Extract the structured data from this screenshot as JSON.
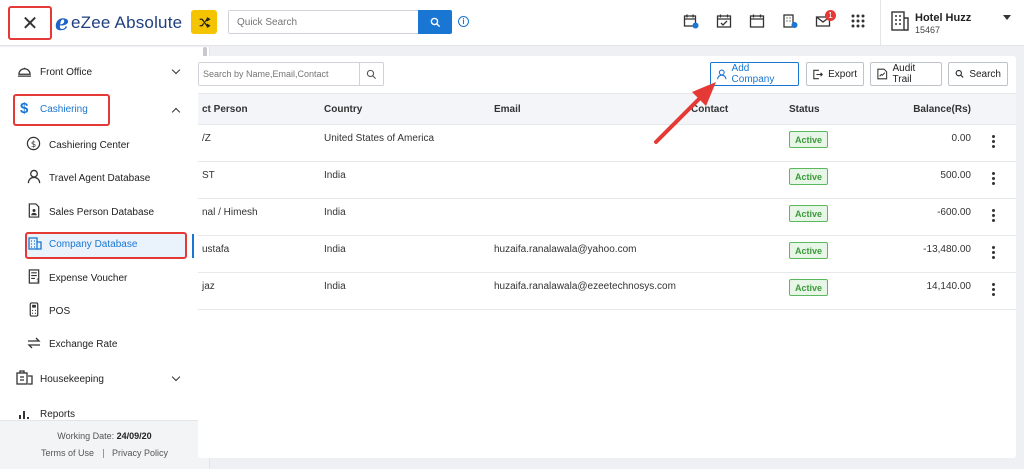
{
  "app": {
    "logo_mark": "e",
    "title": "eZee Absolute"
  },
  "search": {
    "placeholder": "Quick Search"
  },
  "notifications": {
    "badge_count": "1"
  },
  "hotel": {
    "name": "Hotel Huzz",
    "code": "15467"
  },
  "sidebar": {
    "items": [
      {
        "label": "Front Office",
        "icon": "bell-icon",
        "expanded": false
      },
      {
        "label": "Cashiering",
        "icon": "dollar-icon",
        "expanded": true
      },
      {
        "label": "Cashiering Center",
        "icon": "dollar-circle-icon"
      },
      {
        "label": "Travel Agent Database",
        "icon": "person-icon"
      },
      {
        "label": "Sales Person Database",
        "icon": "id-card-icon"
      },
      {
        "label": "Company Database",
        "icon": "building-icon",
        "active": true
      },
      {
        "label": "Expense Voucher",
        "icon": "receipt-icon"
      },
      {
        "label": "POS",
        "icon": "pos-terminal-icon"
      },
      {
        "label": "Exchange Rate",
        "icon": "exchange-icon"
      },
      {
        "label": "Housekeeping",
        "icon": "broom-icon",
        "expanded": false
      },
      {
        "label": "Reports",
        "icon": "bar-chart-icon"
      }
    ],
    "footer": {
      "working_date_label": "Working Date:",
      "working_date": "24/09/20",
      "terms": "Terms of Use",
      "privacy": "Privacy Policy"
    }
  },
  "toolbar": {
    "search_placeholder": "Search by Name,Email,Contact",
    "add_company": "Add Company",
    "export": "Export",
    "audit_trail": "Audit Trail",
    "search": "Search"
  },
  "table": {
    "headers": [
      "ct Person",
      "Country",
      "Email",
      "Contact",
      "Status",
      "Balance(Rs)"
    ],
    "rows": [
      {
        "person": "/Z",
        "country": "United States of America",
        "email": "",
        "contact": "",
        "status": "Active",
        "balance": "0.00"
      },
      {
        "person": "ST",
        "country": "India",
        "email": "",
        "contact": "",
        "status": "Active",
        "balance": "500.00"
      },
      {
        "person": "nal / Himesh",
        "country": "India",
        "email": "",
        "contact": "",
        "status": "Active",
        "balance": "-600.00"
      },
      {
        "person": "ustafa",
        "country": "India",
        "email": "huzaifa.ranalawala@yahoo.com",
        "contact": "",
        "status": "Active",
        "balance": "-13,480.00"
      },
      {
        "person": "jaz",
        "country": "India",
        "email": "huzaifa.ranalawala@ezeetechnosys.com",
        "contact": "",
        "status": "Active",
        "balance": "14,140.00"
      }
    ]
  },
  "colors": {
    "accent": "#1976d2",
    "highlight": "#e53935",
    "active_status": "#3c9a3c",
    "shuffle": "#f5c400"
  }
}
